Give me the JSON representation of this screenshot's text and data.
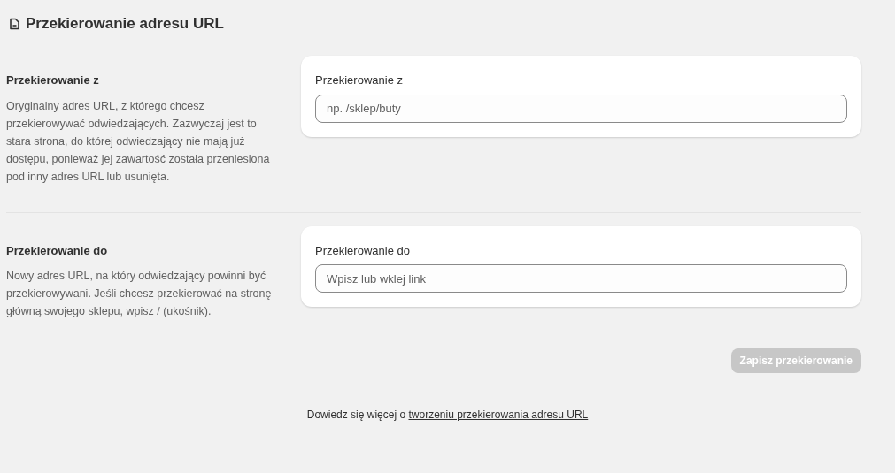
{
  "page": {
    "title": "Przekierowanie adresu URL"
  },
  "sections": [
    {
      "heading": "Przekierowanie z",
      "description": "Oryginalny adres URL, z którego chcesz przekierowywać odwiedzających. Zazwyczaj jest to stara strona, do której odwiedzający nie mają już dostępu, ponieważ jej zawartość została przeniesiona pod inny adres URL lub usunięta.",
      "field": {
        "label": "Przekierowanie z",
        "placeholder": "np. /sklep/buty"
      }
    },
    {
      "heading": "Przekierowanie do",
      "description": "Nowy adres URL, na który odwiedzający powinni być przekierowywani. Jeśli chcesz przekierować na stronę główną swojego sklepu, wpisz / (ukośnik).",
      "field": {
        "label": "Przekierowanie do",
        "placeholder": "Wpisz lub wklej link"
      }
    }
  ],
  "save_button": {
    "label": "Zapisz przekierowanie",
    "disabled": true
  },
  "footer": {
    "text": "Dowiedz się więcej o",
    "link": "tworzeniu przekierowania adresu URL"
  }
}
